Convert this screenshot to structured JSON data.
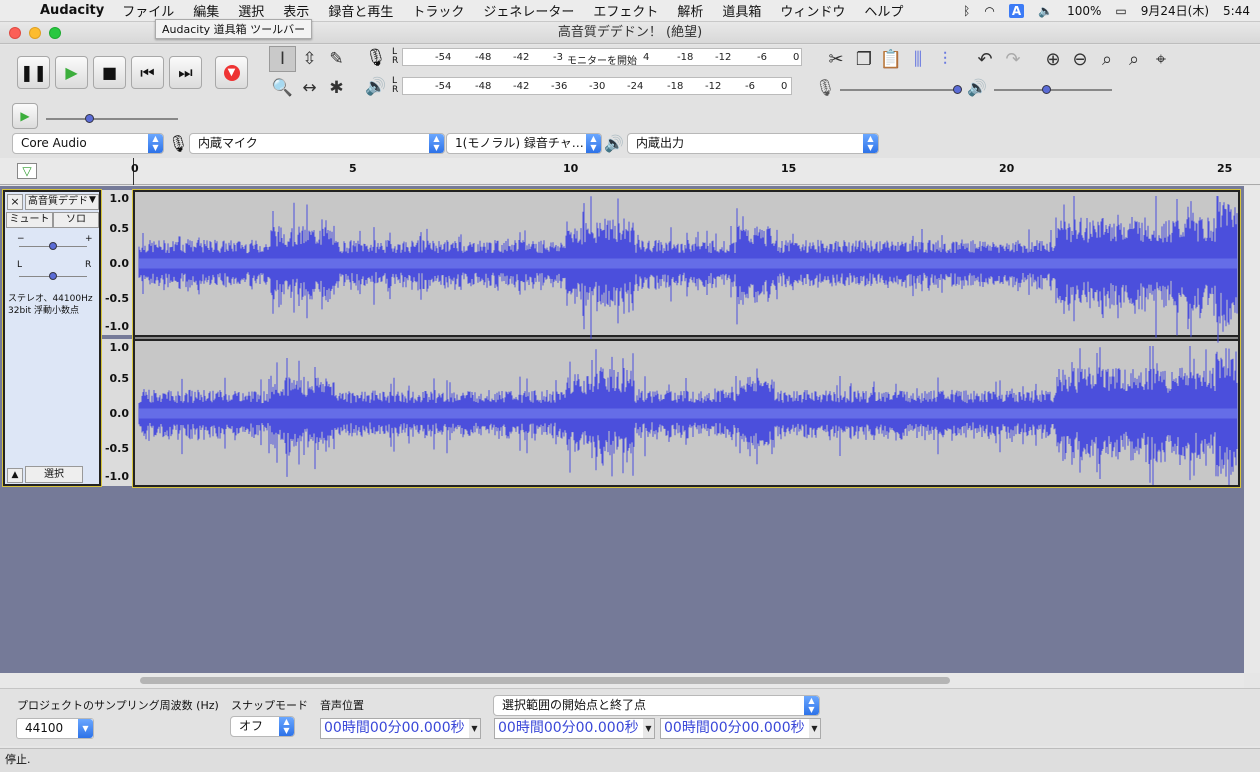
{
  "menubar": {
    "app_name": "Audacity",
    "items": [
      "ファイル",
      "編集",
      "選択",
      "表示",
      "録音と再生",
      "トラック",
      "ジェネレーター",
      "エフェクト",
      "解析",
      "道具箱",
      "ウィンドウ",
      "ヘルプ"
    ],
    "battery": "100%",
    "datetime": "9月24日(木)",
    "time": "5:44",
    "ime_label": "A"
  },
  "tooltip": "Audacity 道具箱 ツールバー",
  "window": {
    "title": "高音質デデドン！ (絶望)"
  },
  "meters": {
    "record_scale": [
      "-54",
      "-48",
      "-42",
      "-3",
      "モニターを開始",
      "4",
      "-18",
      "-12",
      "-6",
      "0"
    ],
    "play_scale": [
      "-54",
      "-48",
      "-42",
      "-36",
      "-30",
      "-24",
      "-18",
      "-12",
      "-6",
      "0"
    ]
  },
  "devices": {
    "host": "Core Audio",
    "input": "内蔵マイク",
    "channels": "1(モノラル) 録音チャ…",
    "output": "内蔵出力"
  },
  "ruler": {
    "ticks": [
      "0",
      "5",
      "10",
      "15",
      "20",
      "25"
    ]
  },
  "track": {
    "name": "高音質デデド",
    "mute_label": "ミュート",
    "solo_label": "ソロ",
    "gain_min": "−",
    "gain_max": "+",
    "pan_left": "L",
    "pan_right": "R",
    "info_line1": "ステレオ、44100Hz",
    "info_line2": "32bit 浮動小数点",
    "select_label": "選択",
    "vruler_labels": [
      "1.0",
      "0.5",
      "0.0",
      "-0.5",
      "-1.0"
    ]
  },
  "selection_toolbar": {
    "rate_label": "プロジェクトのサンプリング周波数 (Hz)",
    "rate_value": "44100",
    "snap_label": "スナップモード",
    "snap_value": "オフ",
    "position_label": "音声位置",
    "position_value": "00時間00分00.000秒",
    "range_mode": "選択範囲の開始点と終了点",
    "start_value": "00時間00分00.000秒",
    "end_value": "00時間00分00.000秒"
  },
  "status": "停止.",
  "colors": {
    "waveform": "#4b4fdc",
    "track_bg": "#c7c7c7",
    "empty_area": "#757a98"
  }
}
